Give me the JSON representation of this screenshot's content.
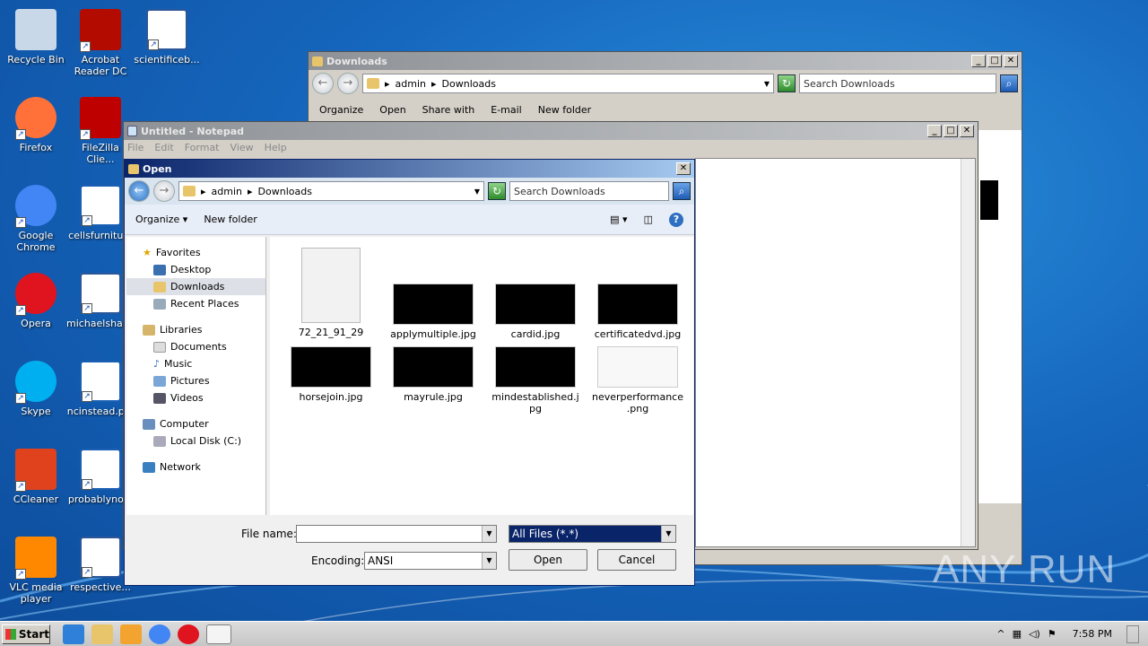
{
  "desktop": {
    "icons": [
      {
        "label": "Recycle Bin",
        "icon": "recycle-bin-icon",
        "color": "#c8d8e8"
      },
      {
        "label": "Acrobat Reader DC",
        "icon": "acrobat-icon",
        "color": "#b30b00"
      },
      {
        "label": "scientificeb...",
        "icon": "word-doc-icon",
        "color": "#2b579a"
      },
      {
        "label": "Firefox",
        "icon": "firefox-icon",
        "color": "#ff7139"
      },
      {
        "label": "FileZilla Clie...",
        "icon": "filezilla-icon",
        "color": "#bf0000"
      },
      {
        "label": "Google Chrome",
        "icon": "chrome-icon",
        "color": "#4285f4"
      },
      {
        "label": "cellsfurnitu...",
        "icon": "file-icon",
        "color": "#1a5fb4"
      },
      {
        "label": "Opera",
        "icon": "opera-icon",
        "color": "#e0141e"
      },
      {
        "label": "michaelshar...",
        "icon": "word-doc-icon",
        "color": "#2b579a"
      },
      {
        "label": "Skype",
        "icon": "skype-icon",
        "color": "#00aff0"
      },
      {
        "label": "ncinstead.p...",
        "icon": "file-icon",
        "color": "#1a5fb4"
      },
      {
        "label": "CCleaner",
        "icon": "ccleaner-icon",
        "color": "#e0421e"
      },
      {
        "label": "probablyno...",
        "icon": "file-icon",
        "color": "#1a5fb4"
      },
      {
        "label": "VLC media player",
        "icon": "vlc-icon",
        "color": "#ff8800"
      },
      {
        "label": "respective...",
        "icon": "word-doc-icon",
        "color": "#2b579a"
      }
    ]
  },
  "explorer": {
    "title": "Downloads",
    "breadcrumb": [
      "admin",
      "Downloads"
    ],
    "search_placeholder": "Search Downloads",
    "commands": [
      "Organize",
      "Open",
      "Share with",
      "E-mail",
      "New folder"
    ]
  },
  "notepad": {
    "title": "Untitled - Notepad",
    "menu": [
      "File",
      "Edit",
      "Format",
      "View",
      "Help"
    ]
  },
  "open_dialog": {
    "title": "Open",
    "breadcrumb": [
      "admin",
      "Downloads"
    ],
    "search_placeholder": "Search Downloads",
    "organize": "Organize",
    "new_folder": "New folder",
    "nav": {
      "favorites": "Favorites",
      "desktop": "Desktop",
      "downloads": "Downloads",
      "recent": "Recent Places",
      "libraries": "Libraries",
      "documents": "Documents",
      "music": "Music",
      "pictures": "Pictures",
      "videos": "Videos",
      "computer": "Computer",
      "local_disk": "Local Disk (C:)",
      "network": "Network"
    },
    "files": [
      {
        "name": "72_21_91_29",
        "kind": "blank"
      },
      {
        "name": "applymultiple.jpg",
        "kind": "dark"
      },
      {
        "name": "cardid.jpg",
        "kind": "dark"
      },
      {
        "name": "certificatedvd.jpg",
        "kind": "dark"
      },
      {
        "name": "horsejoin.jpg",
        "kind": "dark"
      },
      {
        "name": "mayrule.jpg",
        "kind": "dark"
      },
      {
        "name": "mindestablished.jpg",
        "kind": "dark"
      },
      {
        "name": "neverperformance.png",
        "kind": "light"
      }
    ],
    "file_name_label": "File name:",
    "file_name_value": "",
    "file_type": "All Files  (*.*)",
    "encoding_label": "Encoding:",
    "encoding_value": "ANSI",
    "open_button": "Open",
    "cancel_button": "Cancel"
  },
  "taskbar": {
    "start": "Start",
    "clock": "7:58 PM"
  },
  "watermark": "ANY RUN"
}
